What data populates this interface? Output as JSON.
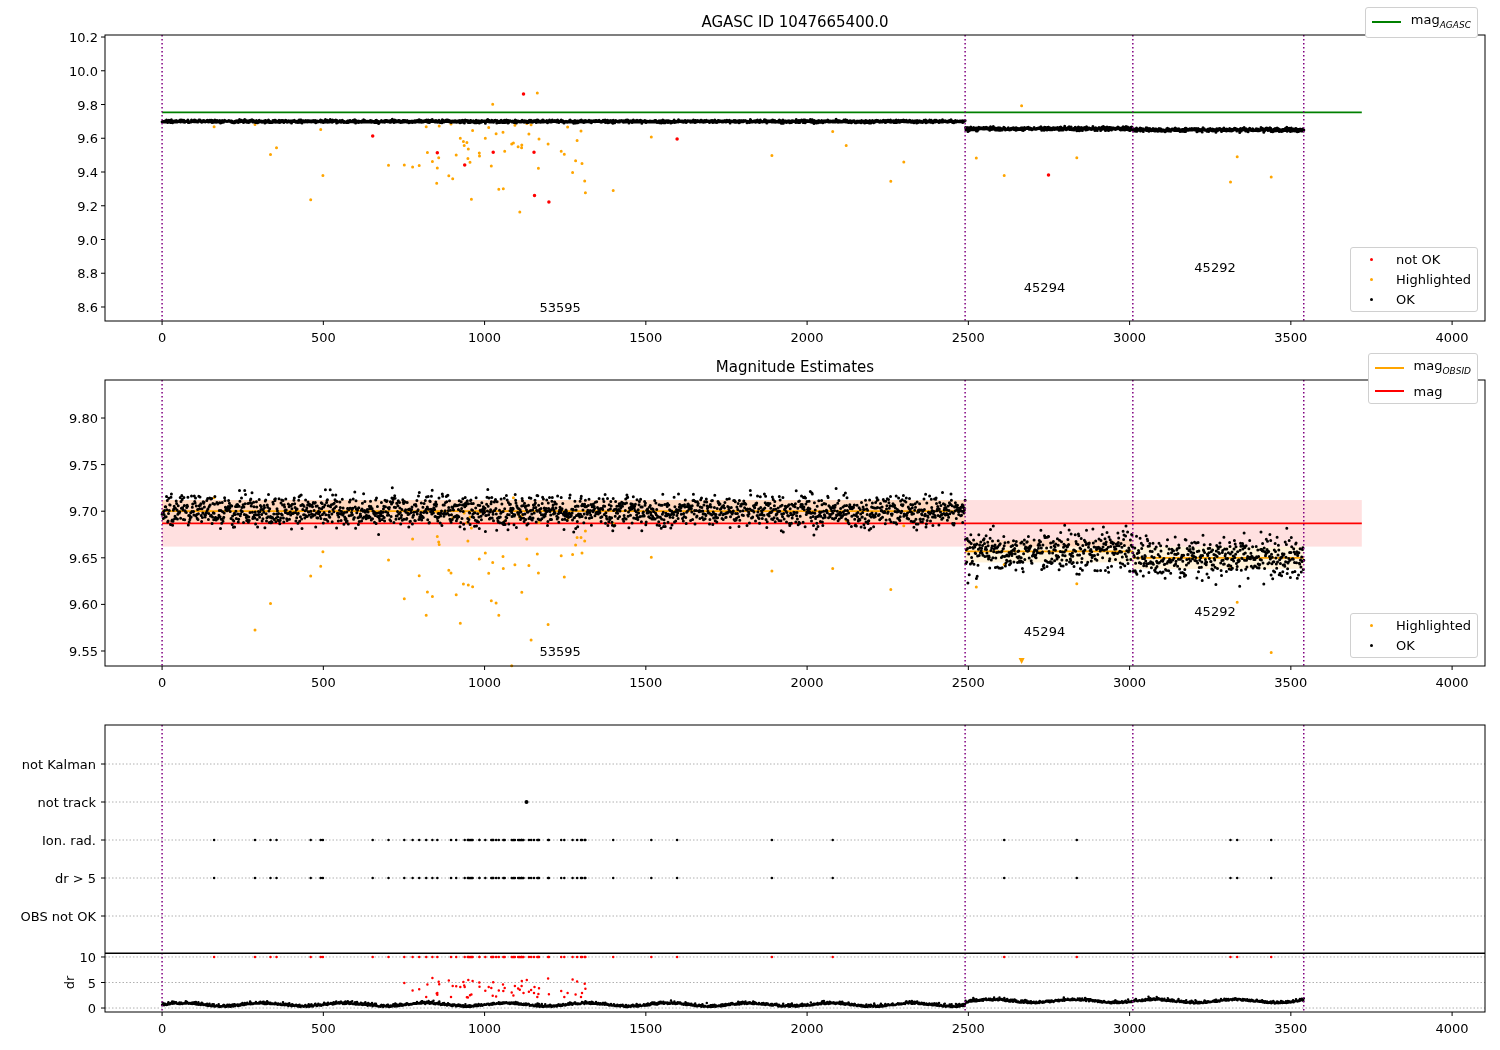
{
  "panels": [
    {
      "kind": "magnitude",
      "chart_data": {
        "type": "scatter",
        "title": "AGASC ID 1047665400.0",
        "xlim": [
          -177,
          4102
        ],
        "ylim": [
          8.517,
          10.212
        ],
        "xticks": [
          0,
          500,
          1000,
          1500,
          2000,
          2500,
          3000,
          3500,
          4000
        ],
        "yticks": [
          {
            "value": 8.6,
            "label": "8.6"
          },
          {
            "value": 8.8,
            "label": "8.8"
          },
          {
            "value": 9.0,
            "label": "9.0"
          },
          {
            "value": 9.2,
            "label": "9.2"
          },
          {
            "value": 9.4,
            "label": "9.4"
          },
          {
            "value": 9.6,
            "label": "9.6"
          },
          {
            "value": 9.8,
            "label": "9.8"
          },
          {
            "value": 10.0,
            "label": "10.0"
          },
          {
            "value": 10.2,
            "label": "10.2"
          }
        ],
        "series": [
          {
            "name": "mag$_{AGASC}$",
            "type": "line",
            "color": "#008000",
            "x": [
              0,
              3720
            ],
            "values": [
              9.753,
              9.753
            ]
          },
          {
            "name": "not OK",
            "type": "scatter",
            "color": "#ff0000"
          },
          {
            "name": "Highlighted",
            "type": "scatter",
            "color": "#ffa500"
          },
          {
            "name": "OK",
            "type": "scatter",
            "color": "#000000"
          }
        ],
        "ref_lines": [
          {
            "axis": "x",
            "value": 0,
            "color": "#800080"
          },
          {
            "axis": "x",
            "value": 2490,
            "color": "#800080"
          },
          {
            "axis": "x",
            "value": 3010,
            "color": "#800080"
          },
          {
            "axis": "x",
            "value": 3540,
            "color": "#800080"
          }
        ],
        "annotations": [
          "53595",
          "45294",
          "45292"
        ]
      }
    },
    {
      "kind": "magnitude",
      "chart_data": {
        "type": "scatter",
        "title": "Magnitude Estimates",
        "xlim": [
          -177,
          4102
        ],
        "ylim": [
          9.5339,
          9.8408
        ],
        "xticks": [
          0,
          500,
          1000,
          1500,
          2000,
          2500,
          3000,
          3500,
          4000
        ],
        "yticks": [
          {
            "value": 9.55,
            "label": "9.55"
          },
          {
            "value": 9.6,
            "label": "9.60"
          },
          {
            "value": 9.65,
            "label": "9.65"
          },
          {
            "value": 9.7,
            "label": "9.70"
          },
          {
            "value": 9.75,
            "label": "9.75"
          },
          {
            "value": 9.8,
            "label": "9.80"
          }
        ],
        "series": [
          {
            "name": "mag$_{OBSID}$",
            "type": "line",
            "color": "#ffa500",
            "x": [
              0,
              2490,
              2490,
              3010,
              3010,
              3540
            ],
            "values": [
              9.7,
              9.7,
              9.657,
              9.657,
              9.65,
              9.65
            ]
          },
          {
            "name": "mag",
            "type": "line",
            "color": "#ff0000",
            "x": [
              0,
              3720
            ],
            "values": [
              9.687,
              9.687
            ]
          },
          {
            "name": "Highlighted",
            "type": "scatter",
            "color": "#ffa500"
          },
          {
            "name": "OK",
            "type": "scatter",
            "color": "#000000"
          }
        ],
        "bands": [
          {
            "axis": "y",
            "from": 9.662,
            "to": 9.712,
            "color": "#ff0000"
          }
        ],
        "ref_lines": [
          {
            "axis": "x",
            "value": 0,
            "color": "#800080"
          },
          {
            "axis": "x",
            "value": 2490,
            "color": "#800080"
          },
          {
            "axis": "x",
            "value": 3010,
            "color": "#800080"
          },
          {
            "axis": "x",
            "value": 3540,
            "color": "#800080"
          }
        ],
        "annotations": [
          "53595",
          "45294",
          "45292"
        ]
      }
    },
    {
      "kind": "flags",
      "chart_data": {
        "type": "scatter",
        "orientation": "horizontal",
        "grid": true,
        "xlim": [
          -177,
          4102
        ],
        "categories": [
          "not Kalman",
          "not track",
          "Ion. rad.",
          "dr > 5",
          "OBS not OK"
        ],
        "ref_lines": [
          {
            "axis": "x",
            "value": 0,
            "color": "#800080"
          },
          {
            "axis": "x",
            "value": 2490,
            "color": "#800080"
          },
          {
            "axis": "x",
            "value": 3010,
            "color": "#800080"
          },
          {
            "axis": "x",
            "value": 3540,
            "color": "#800080"
          }
        ]
      }
    },
    {
      "kind": "dr",
      "chart_data": {
        "type": "scatter",
        "ylabel": "dr",
        "grid": true,
        "xlim": [
          -177,
          4102
        ],
        "ylim": [
          -0.78,
          10.78
        ],
        "xticks": [
          0,
          500,
          1000,
          1500,
          2000,
          2500,
          3000,
          3500,
          4000
        ],
        "yticks": [
          0,
          5,
          10
        ],
        "ref_lines": [
          {
            "axis": "x",
            "value": 0,
            "color": "#800080"
          },
          {
            "axis": "x",
            "value": 2490,
            "color": "#800080"
          },
          {
            "axis": "x",
            "value": 3010,
            "color": "#800080"
          },
          {
            "axis": "x",
            "value": 3540,
            "color": "#800080"
          }
        ]
      }
    }
  ]
}
